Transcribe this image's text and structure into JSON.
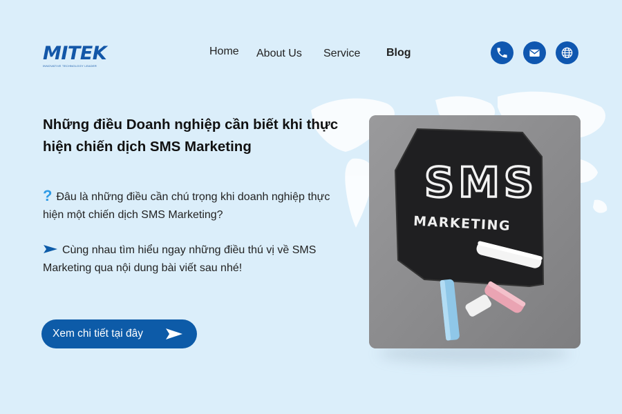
{
  "brand": {
    "name": "MITEK",
    "tagline": "INNOVATIVE TECHNOLOGY LEADER"
  },
  "nav": {
    "home": "Home",
    "about": "About Us",
    "service": "Service",
    "blog": "Blog"
  },
  "contact_icons": [
    "phone-icon",
    "mail-icon",
    "globe-icon"
  ],
  "hero": {
    "title": "Những điều Doanh nghiệp cần biết khi thực hiện chiến dịch SMS Marketing",
    "para1": "Đâu là những điều cần chú trọng khi doanh nghiệp thực hiện một chiến dịch SMS Marketing?",
    "para2": "Cùng nhau tìm hiểu ngay những điều thú vị về SMS Marketing qua nội dung bài viết sau nhé!",
    "cta_label": "Xem chi tiết tại đây"
  },
  "image": {
    "slate_text_1": "SMS",
    "slate_text_2": "MARKETING"
  },
  "colors": {
    "background": "#dbeefa",
    "brand_blue": "#0f57b0",
    "button_blue": "#0d5ba8",
    "question_icon": "#2f9be6"
  }
}
